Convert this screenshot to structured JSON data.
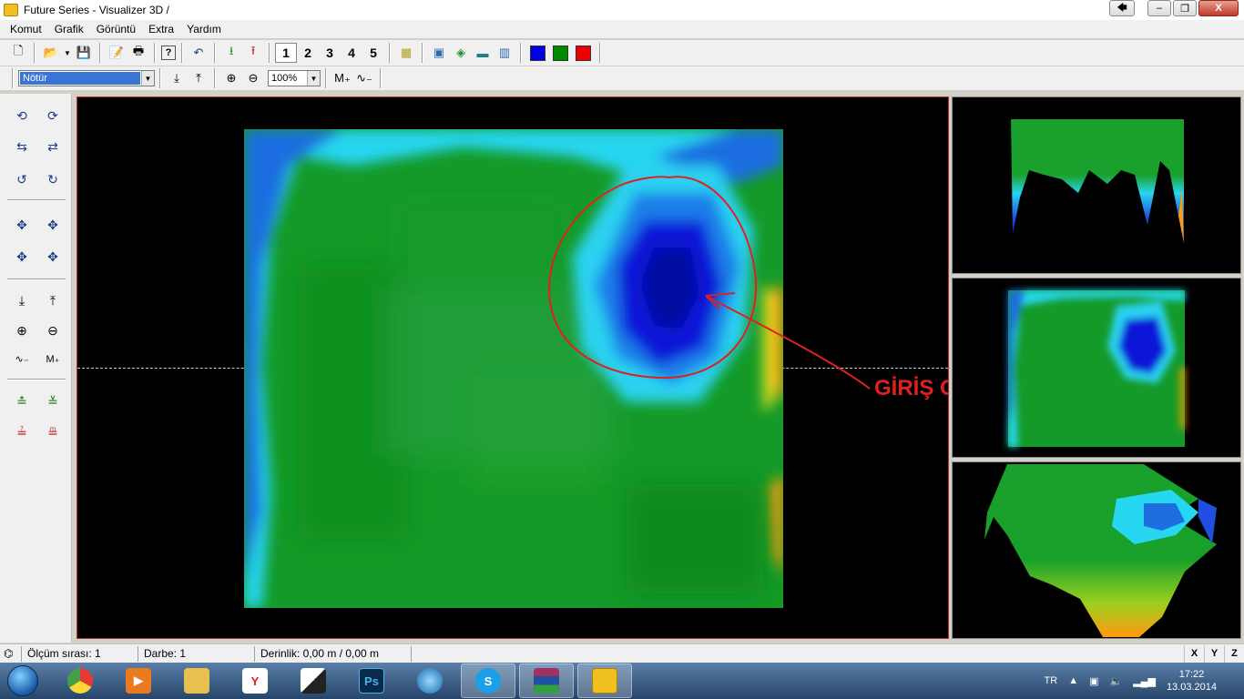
{
  "window": {
    "title": "Future Series - Visualizer 3D /",
    "minimize": "🡄",
    "restore": "–",
    "maximize": "❐",
    "close": "X"
  },
  "menu": [
    "Komut",
    "Grafik",
    "Görüntü",
    "Extra",
    "Yardım"
  ],
  "toolbar": {
    "views": [
      "1",
      "2",
      "3",
      "4",
      "5"
    ],
    "colors": [
      "#0000e0",
      "#008a00",
      "#ee0000"
    ]
  },
  "toolbar2": {
    "mode_value": "Nötür",
    "zoom_value": "100%"
  },
  "annotation": {
    "label": "GİRİŞ OLABİLİR",
    "color": "#e02020"
  },
  "statusbar": {
    "measure_line": "Ölçüm sırası: 1",
    "pulse": "Darbe: 1",
    "depth": "Derinlik: 0,00 m / 0,00 m",
    "axes": [
      "X",
      "Y",
      "Z"
    ]
  },
  "taskbar": {
    "apps": [
      "chrome-icon",
      "media-player-icon",
      "explorer-icon",
      "yandex-icon",
      "app-icon",
      "photoshop-icon",
      "network-icon",
      "skype-icon",
      "winrar-icon",
      "visualizer-icon"
    ],
    "photoshop_label": "Ps",
    "yandex_label": "Y",
    "language": "TR",
    "time": "17:22",
    "date": "13.03.2014"
  }
}
